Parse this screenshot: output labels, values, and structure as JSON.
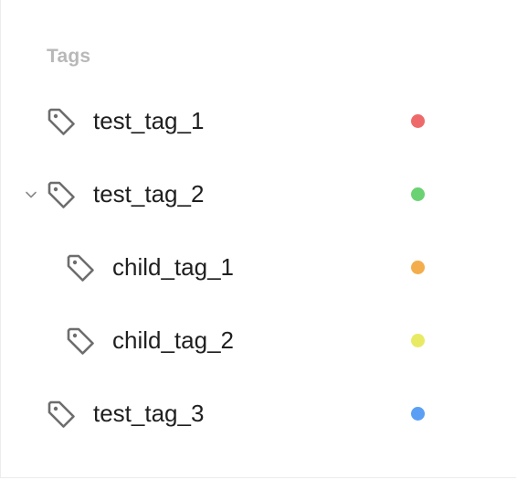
{
  "section": {
    "title": "Tags"
  },
  "tags": [
    {
      "label": "test_tag_1",
      "color": "#ee6a6a",
      "level": 0,
      "expanded": null
    },
    {
      "label": "test_tag_2",
      "color": "#6bd274",
      "level": 0,
      "expanded": true
    },
    {
      "label": "child_tag_1",
      "color": "#f3ad4c",
      "level": 1,
      "expanded": null
    },
    {
      "label": "child_tag_2",
      "color": "#e9ea64",
      "level": 1,
      "expanded": null
    },
    {
      "label": "test_tag_3",
      "color": "#5b9ff5",
      "level": 0,
      "expanded": null
    }
  ]
}
